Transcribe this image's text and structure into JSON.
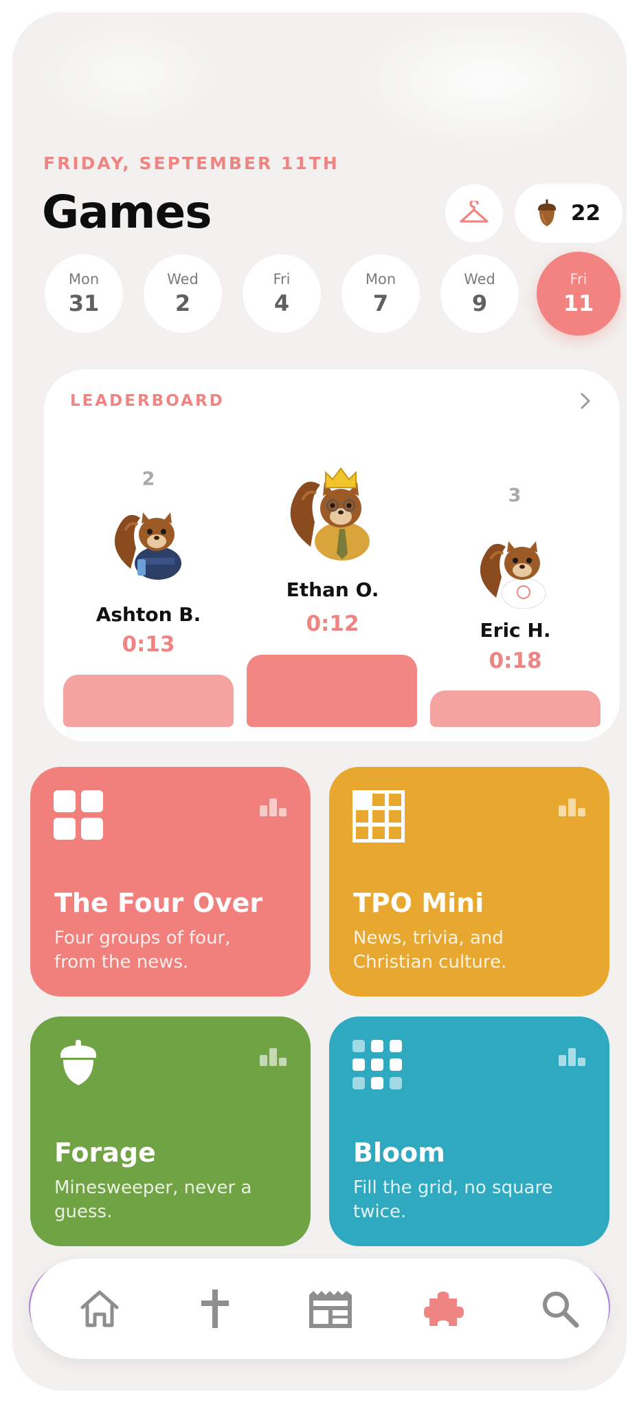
{
  "header": {
    "date": "FRIDAY, SEPTEMBER 11TH",
    "title": "Games",
    "acorn_count": "22",
    "icons": {
      "wardrobe": "hanger-icon",
      "currency": "acorn-icon"
    }
  },
  "days": [
    {
      "name": "Mon",
      "num": "31",
      "selected": false
    },
    {
      "name": "Wed",
      "num": "2",
      "selected": false
    },
    {
      "name": "Fri",
      "num": "4",
      "selected": false
    },
    {
      "name": "Mon",
      "num": "7",
      "selected": false
    },
    {
      "name": "Wed",
      "num": "9",
      "selected": false
    },
    {
      "name": "Fri",
      "num": "11",
      "selected": true
    }
  ],
  "leaderboard": {
    "label": "LEADERBOARD",
    "entries": [
      {
        "rank": "2",
        "name": "Ashton B.",
        "time": "0:13"
      },
      {
        "rank": "1",
        "name": "Ethan O.",
        "time": "0:12"
      },
      {
        "rank": "3",
        "name": "Eric H.",
        "time": "0:18"
      }
    ]
  },
  "games": [
    {
      "title": "The Four Over",
      "desc": "Four groups of four, from the news.",
      "color": "#f17f7c",
      "icon": "four-squares-icon"
    },
    {
      "title": "TPO Mini",
      "desc": "News, trivia, and Christian culture.",
      "color": "#e8a72e",
      "icon": "crossword-grid-icon"
    },
    {
      "title": "Forage",
      "desc": "Minesweeper, never a guess.",
      "color": "#6fa343",
      "icon": "acorn-icon"
    },
    {
      "title": "Bloom",
      "desc": "Fill the grid, no square twice.",
      "color": "#2ea9c0",
      "icon": "dot-grid-icon"
    }
  ],
  "nav": {
    "items": [
      "home",
      "cross",
      "news",
      "games",
      "search"
    ],
    "active": "games",
    "accent": "#ef8583"
  }
}
